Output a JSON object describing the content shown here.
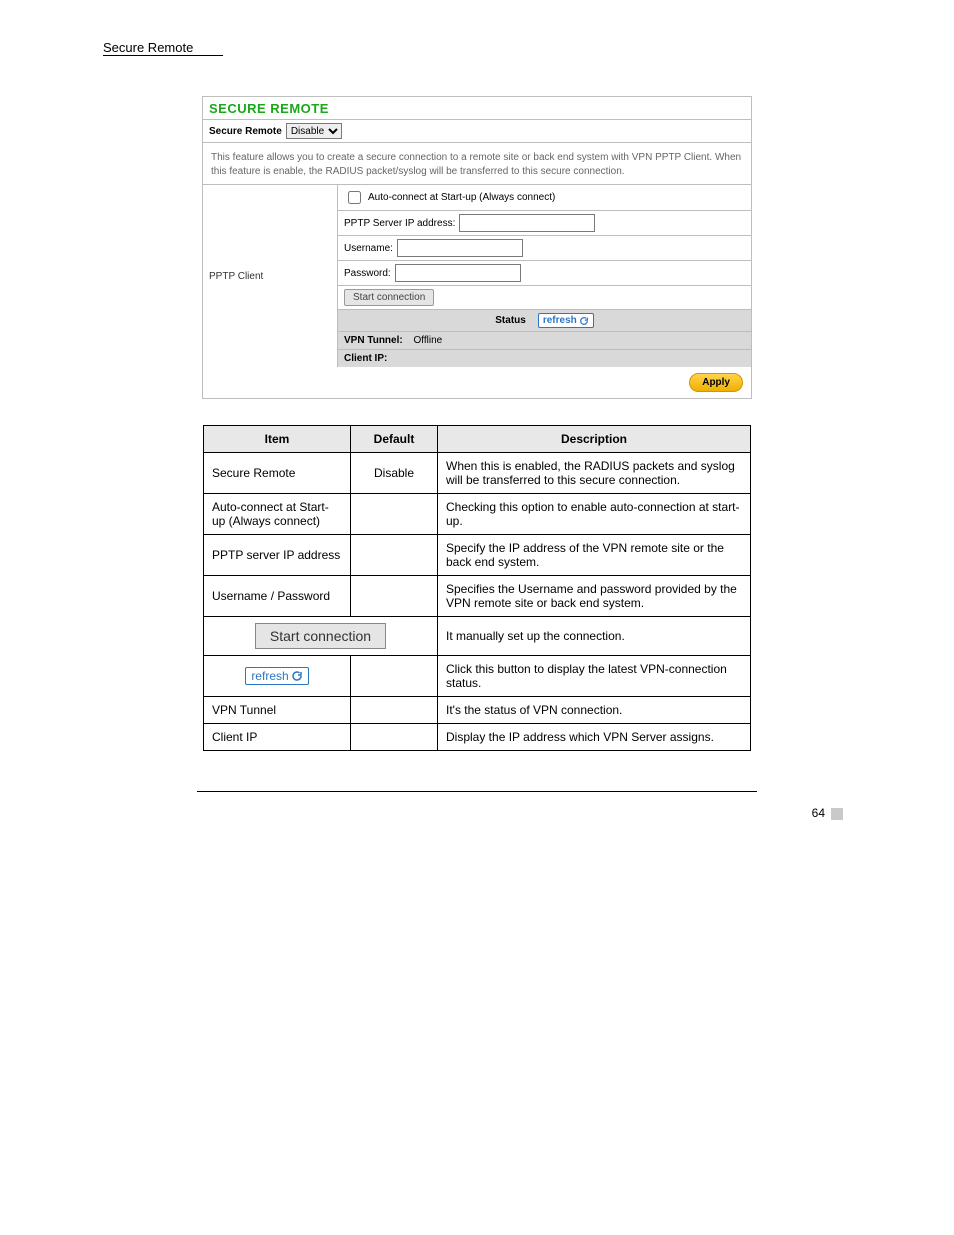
{
  "header": {
    "section": "Secure Remote"
  },
  "panel": {
    "title": "SECURE REMOTE",
    "toggle_label": "Secure Remote",
    "toggle_value": "Disable",
    "description": "This feature allows you to create a secure connection to a remote site or back end system with VPN PPTP Client. When this feature is enable, the RADIUS packet/syslog will be transferred to this secure connection.",
    "left_label": "PPTP Client",
    "auto_connect_label": "Auto-connect at Start-up (Always connect)",
    "ip_label": "PPTP Server IP address:",
    "user_label": "Username:",
    "pass_label": "Password:",
    "start_btn": "Start connection",
    "status_label": "Status",
    "refresh_label": "refresh",
    "vpn_tunnel_label": "VPN Tunnel:",
    "vpn_tunnel_value": "Offline",
    "client_ip_label": "Client IP:",
    "apply_btn": "Apply"
  },
  "doc": {
    "head_item": "Item",
    "head_default": "Default",
    "head_desc": "Description",
    "rows": [
      {
        "item": "Secure Remote",
        "default": "Disable",
        "desc": "When this is enabled, the RADIUS packets and syslog will be transferred to this secure connection."
      },
      {
        "item": "Auto-connect at Start-up (Always connect)",
        "default": "",
        "desc": "Checking this option to enable auto-connection at start-up."
      },
      {
        "item": "PPTP server IP address",
        "default": "",
        "desc": "Specify the IP address of the VPN remote site or the back end system."
      },
      {
        "item": "Username / Password",
        "default": "",
        "desc": "Specifies the Username and password provided by the VPN remote site or back end system."
      },
      {
        "item": "It manually set up the connection.",
        "default": "",
        "desc": ""
      },
      {
        "item": "",
        "default": "",
        "desc": "Click this button to display the latest VPN-connection status."
      },
      {
        "item": "VPN Tunnel",
        "default": "",
        "desc": "It's the status of VPN connection."
      },
      {
        "item": "Client IP",
        "default": "",
        "desc": "Display the IP address which VPN Server assigns."
      }
    ]
  },
  "footer": {
    "page": "64"
  }
}
